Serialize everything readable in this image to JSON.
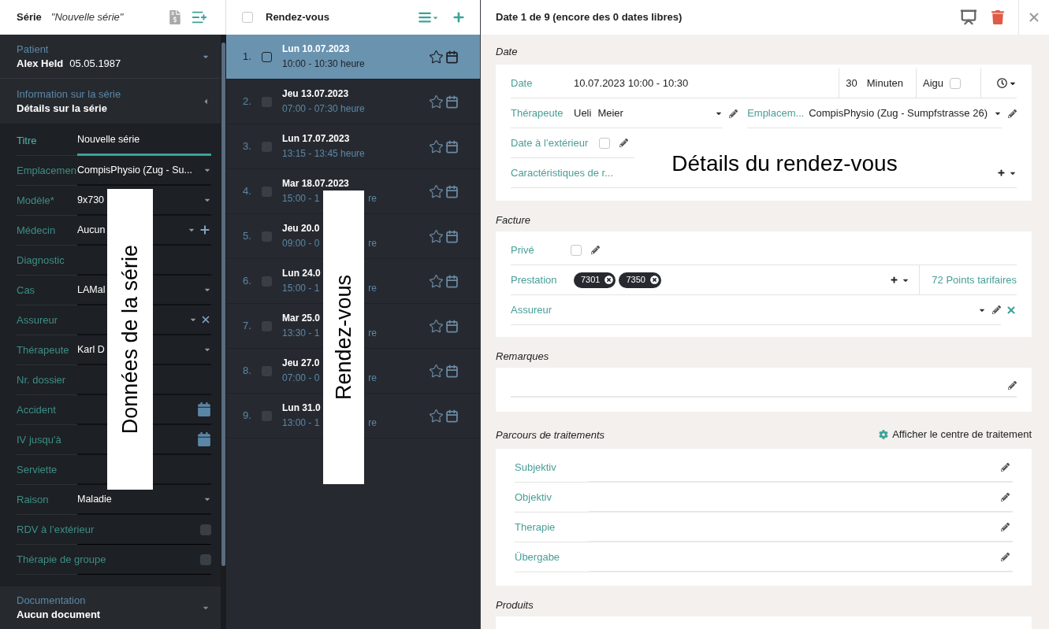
{
  "series_panel": {
    "header": {
      "label": "Série",
      "title": "\"Nouvelle série\""
    },
    "patient": {
      "label": "Patient",
      "name": "Alex Held",
      "birthdate": "05.05.1987"
    },
    "info": {
      "label": "Information sur la série",
      "value": "Détails sur la série",
      "expanded": true
    },
    "fields": [
      {
        "kind": "text",
        "label": "Titre",
        "value": "Nouvelle série",
        "focused": true
      },
      {
        "kind": "select",
        "label": "Emplacemen",
        "value": "CompisPhysio (Zug - Su...",
        "focused": false
      },
      {
        "kind": "select",
        "label": "Modèle*",
        "value": "9x730",
        "focused": false
      },
      {
        "kind": "select",
        "label": "Médecin",
        "value": "Aucun",
        "addable": true,
        "focused": false
      },
      {
        "kind": "text",
        "label": "Diagnostic",
        "focused": false
      },
      {
        "kind": "select",
        "label": "Cas",
        "value": "LAMal",
        "focused": false
      },
      {
        "kind": "select",
        "label": "Assureur",
        "clearable": true,
        "focused": false
      },
      {
        "kind": "select",
        "label": "Thérapeute",
        "value": "Karl D",
        "focused": false
      },
      {
        "kind": "text",
        "label": "Nr. dossier",
        "focused": false
      },
      {
        "kind": "date",
        "label": "Accident",
        "focused": false
      },
      {
        "kind": "date",
        "label": "IV jusqu'à",
        "focused": false
      },
      {
        "kind": "text",
        "label": "Serviette",
        "focused": false
      },
      {
        "kind": "select",
        "label": "Raison",
        "value": "Maladie",
        "focused": false
      },
      {
        "kind": "checkbox",
        "label": "RDV à l’extérieur",
        "checked": false,
        "focused": false
      },
      {
        "kind": "checkbox",
        "label": "Thérapie de groupe",
        "checked": false,
        "focused": false
      }
    ],
    "documentation": {
      "label": "Documentation",
      "value": "Aucun document"
    }
  },
  "appointments_panel": {
    "header": {
      "title": "Rendez-vous",
      "checked": false
    },
    "rows": [
      {
        "number": "1.",
        "date": "Lun 10.07.2023",
        "time": "10:00 - 10:30 heure",
        "selected": true,
        "checked": false
      },
      {
        "number": "2.",
        "date": "Jeu 13.07.2023",
        "time": "07:00 - 07:30 heure",
        "selected": false,
        "checked": false
      },
      {
        "number": "3.",
        "date": "Lun 17.07.2023",
        "time": "13:15 - 13:45 heure",
        "selected": false,
        "checked": false
      },
      {
        "number": "4.",
        "date": "Mar 18.07.2023",
        "time": "15:00 - 1",
        "time_end": "re",
        "selected": false,
        "checked": false
      },
      {
        "number": "5.",
        "date": "Jeu 20.0",
        "time": "09:00 - 0",
        "time_end": "re",
        "selected": false,
        "checked": false
      },
      {
        "number": "6.",
        "date": "Lun 24.0",
        "time": "15:00 - 1",
        "time_end": "re",
        "selected": false,
        "checked": false
      },
      {
        "number": "7.",
        "date": "Mar 25.0",
        "time": "13:30 - 1",
        "time_end": "re",
        "selected": false,
        "checked": false
      },
      {
        "number": "8.",
        "date": "Jeu 27.0",
        "time": "07:00 - 0",
        "time_end": "re",
        "selected": false,
        "checked": false
      },
      {
        "number": "9.",
        "date": "Lun 31.0",
        "time": "13:00 - 1",
        "time_end": "re",
        "selected": false,
        "checked": false
      }
    ]
  },
  "detail_panel": {
    "title": "Date 1 de 9 (encore des 0 dates libres)",
    "date_section": {
      "title": "Date",
      "date_label": "Date",
      "date_value": "10.07.2023 10:00 - 10:30",
      "duration": "30",
      "unit": "Minuten",
      "acute_label": "Aigu",
      "acute_checked": false,
      "therapist_label": "Thérapeute",
      "therapist_first": "Ueli",
      "therapist_last": "Meier",
      "location_label": "Emplacem...",
      "location_value": "CompisPhysio (Zug - Sumpfstrasse 26)",
      "outside_label": "Date à l’extérieur",
      "outside_checked": false,
      "features_label": "Caractéristiques de r..."
    },
    "invoice_section": {
      "title": "Facture",
      "private_label": "Privé",
      "private_checked": false,
      "service_label": "Prestation",
      "services": [
        "7301",
        "7350"
      ],
      "points": "72 Points tarifaires",
      "insurer_label": "Assureur"
    },
    "remarks_section": {
      "title": "Remarques"
    },
    "treatment_section": {
      "title": "Parcours de traitements",
      "link": "Afficher le centre de traitement",
      "items": [
        "Subjektiv",
        "Objektiv",
        "Therapie",
        "Übergabe"
      ]
    },
    "products_section": {
      "title": "Produits"
    }
  },
  "annotations": [
    {
      "text": "Données de la série"
    },
    {
      "text": "Rendez-vous"
    },
    {
      "text": "Détails du rendez-vous"
    }
  ]
}
